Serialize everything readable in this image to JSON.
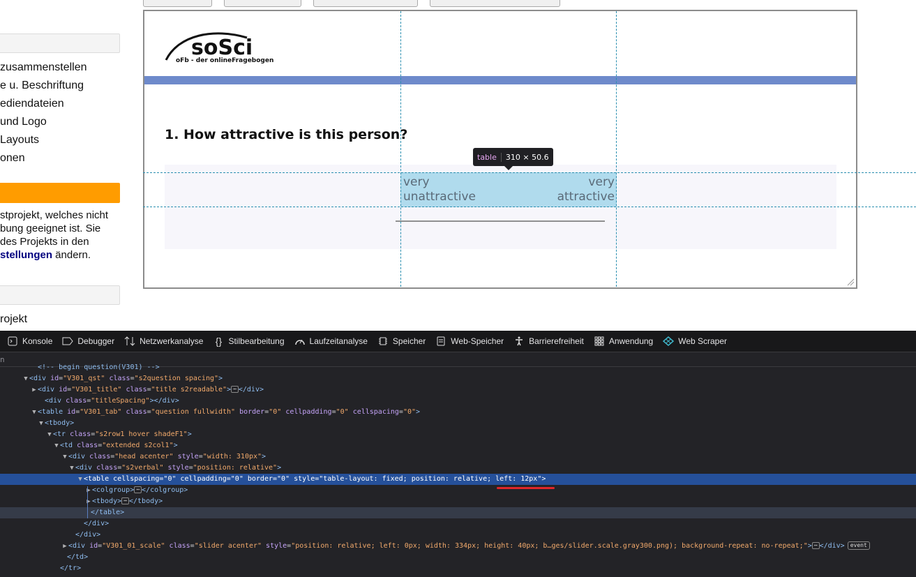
{
  "sidebar": {
    "nav_items": [
      "zusammenstellen",
      "e u. Beschriftung",
      "ediendateien",
      "und Logo",
      "Layouts",
      "onen"
    ],
    "notice": {
      "line1": "stprojekt, welches nicht",
      "line2": "bung geeignet ist. Sie",
      "line3": "des Projekts in den",
      "link": "stellungen",
      "line4_rest": " ändern."
    },
    "bottom_item": "rojekt"
  },
  "preview": {
    "logo": {
      "main": "soSci",
      "sub": "oFb - der onlineFragebogen"
    },
    "question_title": "1. How attractive is this person?",
    "label_left": [
      "very",
      "unattractive"
    ],
    "label_right": [
      "very",
      "attractive"
    ],
    "tooltip": {
      "tag": "table",
      "size": "310 × 50.6"
    },
    "colors": {
      "band": "#6e8acb",
      "highlight": "#98d2e8"
    }
  },
  "devtools": {
    "tabs": [
      {
        "icon": "console-icon",
        "label": "Konsole"
      },
      {
        "icon": "debugger-icon",
        "label": "Debugger"
      },
      {
        "icon": "network-icon",
        "label": "Netzwerkanalyse"
      },
      {
        "icon": "braces-icon",
        "label": "Stilbearbeitung"
      },
      {
        "icon": "performance-icon",
        "label": "Laufzeitanalyse"
      },
      {
        "icon": "memory-icon",
        "label": "Speicher"
      },
      {
        "icon": "storage-icon",
        "label": "Web-Speicher"
      },
      {
        "icon": "accessibility-icon",
        "label": "Barrierefreiheit"
      },
      {
        "icon": "grid-icon",
        "label": "Anwendung"
      },
      {
        "icon": "scraper-icon",
        "label": "Web Scraper"
      }
    ],
    "search_fragment": "n",
    "lines": [
      {
        "text": "<!-- begin question(V301) -->"
      },
      {
        "tag": "div",
        "attrs": [
          [
            "id",
            "V301_qst"
          ],
          [
            "class",
            "s2question spacing"
          ]
        ]
      },
      {
        "tag": "div",
        "attrs": [
          [
            "id",
            "V301_title"
          ],
          [
            "class",
            "title s2readable"
          ]
        ],
        "collapsed": true
      },
      {
        "tag": "div",
        "attrs": [
          [
            "class",
            "titleSpacing"
          ]
        ],
        "empty": true
      },
      {
        "tag": "table",
        "attrs": [
          [
            "id",
            "V301_tab"
          ],
          [
            "class",
            "question fullwidth"
          ],
          [
            "border",
            "0"
          ],
          [
            "cellpadding",
            "0"
          ],
          [
            "cellspacing",
            "0"
          ]
        ]
      },
      {
        "tag": "tbody",
        "attrs": []
      },
      {
        "tag": "tr",
        "attrs": [
          [
            "class",
            "s2row1 hover shadeF1"
          ]
        ]
      },
      {
        "tag": "td",
        "attrs": [
          [
            "class",
            "extended s2col1"
          ]
        ]
      },
      {
        "tag": "div",
        "attrs": [
          [
            "class",
            "head acenter"
          ],
          [
            "style",
            "width: 310px"
          ]
        ]
      },
      {
        "tag": "div",
        "attrs": [
          [
            "class",
            "s2verbal"
          ],
          [
            "style",
            "position: relative"
          ]
        ]
      },
      {
        "tag": "table",
        "attrs": [
          [
            "cellspacing",
            "0"
          ],
          [
            "cellpadding",
            "0"
          ],
          [
            "border",
            "0"
          ],
          [
            "style",
            "table-layout: fixed; position: relative; left: 12px"
          ]
        ]
      },
      {
        "tag": "colgroup",
        "attrs": [],
        "collapsed": true
      },
      {
        "tag": "tbody",
        "attrs": [],
        "collapsed": true
      },
      {
        "close": "table"
      },
      {
        "close": "div"
      },
      {
        "close": "div"
      },
      {
        "tag": "div",
        "attrs": [
          [
            "id",
            "V301_01_scale"
          ],
          [
            "class",
            "slider acenter"
          ],
          [
            "style",
            "position: relative; left: 0px; width: 334px; height: 40px; b…ges/slider.scale.gray300.png); background-repeat: no-repeat;"
          ]
        ],
        "collapsed": true,
        "event": "event"
      },
      {
        "close": "td"
      },
      {
        "close": "tr"
      }
    ]
  }
}
